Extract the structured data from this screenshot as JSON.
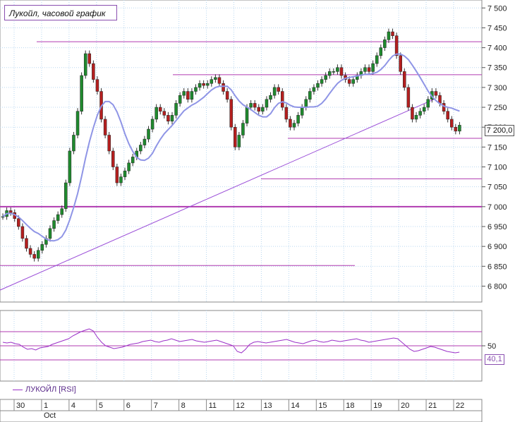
{
  "title": "Лукойл, часовой график",
  "price_label": "7 200,0",
  "rsi_label": "40,1",
  "rsi_tick": "50",
  "legend": "ЛУКОЙЛ [RSI]",
  "colors": {
    "up": "#1f8a2e",
    "down": "#b51f1f",
    "ma": "#8f95e6",
    "level": "#b03bb0",
    "trend": "#9b4fd8",
    "rsi": "#9b30c8",
    "grid": "#b8d7f0"
  },
  "chart_data": [
    {
      "type": "candlestick",
      "title": "Лукойл, часовой график",
      "ylim": [
        6760,
        7520
      ],
      "yticks": [
        "6 800",
        "6 850",
        "6 900",
        "6 950",
        "7 000",
        "7 050",
        "7 100",
        "7 150",
        "7 200",
        "7 250",
        "7 300",
        "7 350",
        "7 400",
        "7 450",
        "7 500"
      ],
      "ytick_values": [
        6800,
        6850,
        6900,
        6950,
        7000,
        7050,
        7100,
        7150,
        7200,
        7250,
        7300,
        7350,
        7400,
        7450,
        7500
      ],
      "x_labels": [
        "30",
        "1",
        "4",
        "5",
        "6",
        "7",
        "8",
        "11",
        "12",
        "13",
        "14",
        "15",
        "18",
        "19",
        "20",
        "21",
        "22"
      ],
      "x_label_sub": "Oct",
      "last_price": 7200,
      "horizontal_levels": [
        7415,
        7332,
        7172,
        7070,
        7000,
        6852
      ],
      "trendline": [
        [
          6790,
          7270
        ]
      ],
      "candles_close": [
        6975,
        6990,
        6985,
        6970,
        6950,
        6920,
        6895,
        6880,
        6870,
        6890,
        6905,
        6920,
        6945,
        6965,
        6980,
        6995,
        7060,
        7140,
        7180,
        7240,
        7330,
        7385,
        7360,
        7320,
        7290,
        7220,
        7180,
        7140,
        7100,
        7060,
        7075,
        7090,
        7110,
        7125,
        7140,
        7155,
        7170,
        7195,
        7220,
        7250,
        7240,
        7230,
        7215,
        7230,
        7260,
        7280,
        7290,
        7270,
        7290,
        7300,
        7310,
        7305,
        7310,
        7320,
        7325,
        7310,
        7290,
        7270,
        7200,
        7150,
        7180,
        7210,
        7250,
        7260,
        7250,
        7240,
        7250,
        7270,
        7280,
        7300,
        7290,
        7250,
        7220,
        7200,
        7210,
        7230,
        7250,
        7270,
        7290,
        7300,
        7310,
        7320,
        7330,
        7340,
        7340,
        7350,
        7330,
        7320,
        7310,
        7320,
        7330,
        7340,
        7350,
        7340,
        7360,
        7380,
        7400,
        7420,
        7440,
        7430,
        7380,
        7340,
        7300,
        7250,
        7220,
        7230,
        7240,
        7250,
        7270,
        7290,
        7280,
        7260,
        7240,
        7220,
        7200,
        7190,
        7205
      ],
      "rsi_values": [
        55,
        54,
        55,
        53,
        52,
        48,
        45,
        46,
        44,
        47,
        48,
        49,
        52,
        54,
        56,
        58,
        60,
        64,
        67,
        70,
        72,
        74,
        71,
        62,
        55,
        50,
        48,
        46,
        47,
        48,
        50,
        52,
        53,
        54,
        56,
        57,
        58,
        56,
        55,
        57,
        58,
        60,
        58,
        56,
        57,
        58,
        59,
        57,
        56,
        55,
        56,
        57,
        58,
        56,
        54,
        52,
        50,
        42,
        40,
        45,
        52,
        55,
        56,
        55,
        54,
        55,
        56,
        57,
        58,
        59,
        57,
        55,
        54,
        53,
        55,
        57,
        58,
        56,
        55,
        56,
        58,
        57,
        56,
        57,
        58,
        59,
        60,
        58,
        57,
        55,
        56,
        57,
        58,
        59,
        60,
        61,
        60,
        55,
        50,
        45,
        42,
        43,
        45,
        47,
        49,
        48,
        46,
        44,
        42,
        41,
        40,
        41
      ],
      "rsi_levels": [
        70,
        50,
        30
      ],
      "rsi_ylim": [
        0,
        100
      ]
    }
  ]
}
